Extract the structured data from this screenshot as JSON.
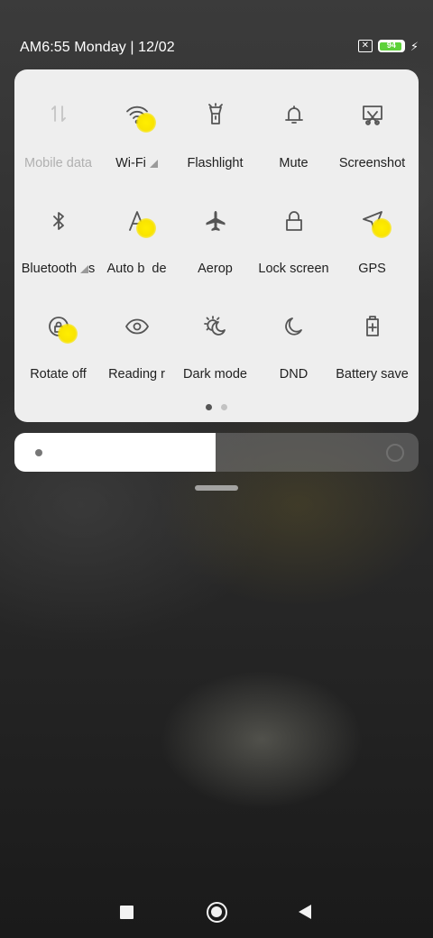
{
  "status_bar": {
    "time_date": "AM6:55  Monday | 12/02",
    "sim_icon": "no-sim-icon",
    "battery_level": "94",
    "battery_fraction": 0.94,
    "battery_color": "#5dd13a",
    "charging_icon": "lightning-icon"
  },
  "quick_settings": {
    "tiles": [
      {
        "id": "mobile-data",
        "label": "Mobile data",
        "icon": "mobile-data-icon",
        "enabled": false
      },
      {
        "id": "wifi",
        "label": "Wi-Fi",
        "icon": "wifi-icon",
        "signal": true
      },
      {
        "id": "flashlight",
        "label": "Flashlight",
        "icon": "flashlight-icon"
      },
      {
        "id": "mute",
        "label": "Mute",
        "icon": "bell-icon"
      },
      {
        "id": "screenshot",
        "label": "Screenshot",
        "icon": "screenshot-icon"
      },
      {
        "id": "bluetooth",
        "label": "Bluetooth",
        "label_suffix": "s",
        "icon": "bluetooth-icon",
        "signal": true
      },
      {
        "id": "auto-brightness",
        "label": "Auto b",
        "label_suffix": "de",
        "icon": "auto-brightness-icon"
      },
      {
        "id": "airplane",
        "label": "Aerop",
        "icon": "airplane-icon"
      },
      {
        "id": "lock-screen",
        "label": "Lock screen",
        "icon": "lock-icon"
      },
      {
        "id": "gps",
        "label": "GPS",
        "icon": "location-arrow-icon"
      },
      {
        "id": "rotate",
        "label": "Rotate off",
        "icon": "rotation-lock-icon"
      },
      {
        "id": "reading",
        "label": "Reading r",
        "icon": "eye-icon"
      },
      {
        "id": "dark-mode",
        "label": "Dark mode",
        "icon": "dark-mode-icon"
      },
      {
        "id": "dnd",
        "label": "DND",
        "icon": "moon-icon"
      },
      {
        "id": "battery-saver",
        "label": "Battery save",
        "icon": "battery-saver-icon"
      }
    ],
    "page_count": 2,
    "active_page": 1
  },
  "brightness": {
    "level_fraction": 0.497,
    "low_icon": "brightness-low-icon",
    "high_icon": "brightness-high-icon"
  },
  "nav_bar": {
    "recent_icon": "recent-apps-icon",
    "home_icon": "home-icon",
    "back_icon": "back-icon"
  },
  "touch_indicators_on": [
    "wifi",
    "auto-brightness",
    "gps",
    "rotate"
  ]
}
